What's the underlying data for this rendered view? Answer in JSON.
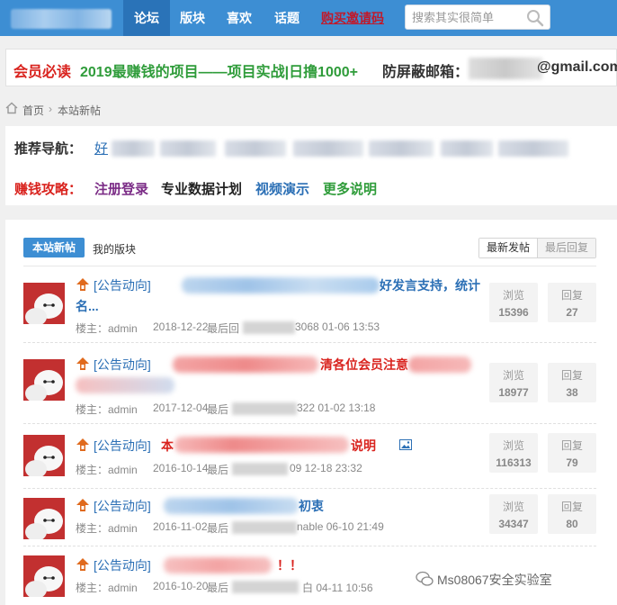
{
  "header": {
    "nav": [
      "论坛",
      "版块",
      "喜欢",
      "话题"
    ],
    "invite": "购买邀请码",
    "search_placeholder": "搜索其实很简单"
  },
  "member_banner": {
    "label": "会员必读",
    "project": "2019最赚钱的项目——项目实战|日撸1000+",
    "email_label": "防屏蔽邮箱：",
    "email_suffix": "@gmail.com"
  },
  "breadcrumb": [
    "首页",
    "本站新帖"
  ],
  "recommend": {
    "nav_label": "推荐导航：",
    "nav_first": "好",
    "guide_label": "赚钱攻略：",
    "guide_links": [
      "注册登录",
      "专业数据计划",
      "视频演示",
      "更多说明"
    ]
  },
  "threads_panel": {
    "tabs": [
      "本站新帖",
      "我的版块"
    ],
    "sort": [
      "最新发帖",
      "最后回复"
    ],
    "stat_labels": [
      "浏览",
      "回复"
    ],
    "threads": [
      {
        "category": "[公告动向]",
        "title_tail": "好发言支持，统计",
        "title_line2": "名...",
        "author": "楼主：admin",
        "date": "2018-12-22",
        "last_label": "最后回",
        "last": "3068 01-06 13:53",
        "views": "15396",
        "replies": "27"
      },
      {
        "category": "[公告动向]",
        "title_tail": "清各位会员注意",
        "title_line2": "",
        "author": "楼主：admin",
        "date": "2017-12-04",
        "last_label": "最后",
        "last": "322 01-02 13:18",
        "views": "18977",
        "replies": "38"
      },
      {
        "category": "[公告动向]",
        "title_head": "本",
        "title_tail": "说明",
        "title_line2": "",
        "author": "楼主：admin",
        "date": "2016-10-14",
        "last_label": "最后",
        "last": "09 12-18 23:32",
        "views": "116313",
        "replies": "79"
      },
      {
        "category": "[公告动向]",
        "title_tail": "初衷",
        "title_line2": "",
        "author": "楼主：admin",
        "date": "2016-11-02",
        "last_label": "最后",
        "last": "nable 06-10 21:49",
        "views": "34347",
        "replies": "80"
      },
      {
        "category": "[公告动向]",
        "title_tail": "！！",
        "title_line2": "",
        "author": "楼主：admin",
        "date": "2016-10-20",
        "last_label": "最后",
        "last": "白 04-11 10:56",
        "views": "",
        "replies": ""
      }
    ]
  },
  "watermark": "Ms08067安全实验室",
  "colors": {
    "topbar": "#3d8ed3",
    "accent_red": "#d9231e",
    "accent_green": "#2f9c3a",
    "link_blue": "#2b6fb5"
  }
}
